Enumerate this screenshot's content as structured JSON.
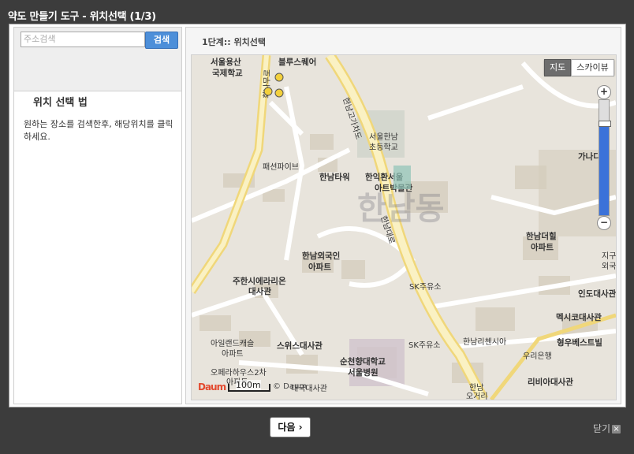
{
  "window": {
    "title": "약도 만들기 도구 - 위치선택 (1/3)"
  },
  "search": {
    "placeholder": "주소검색",
    "button": "검색"
  },
  "help": {
    "title": "위치 선택 법",
    "text": "원하는 장소를 검색한후, 해당위치를 클릭하세요."
  },
  "step": {
    "title": "1단계:: 위치선택"
  },
  "map": {
    "type_buttons": {
      "map": "지도",
      "sky": "스카이뷰"
    },
    "zoom_in": "+",
    "zoom_out": "−",
    "scale": "100m",
    "logo": "Daum",
    "copyright": "© Daum",
    "district": "한남동",
    "labels": {
      "l1": "서울용산",
      "l2": "국제학교",
      "l3": "블루스퀘어",
      "l4": "한남고가차도",
      "l5": "서울한남",
      "l6": "초등학교",
      "l7": "패션파이브",
      "l8": "한남타워",
      "l9": "한익환서울",
      "l10": "아트박물관",
      "l11": "가나다",
      "l12": "한남외국인",
      "l13": "아파트",
      "l14": "한남더힐",
      "l15": "아파트",
      "l16": "주한시에라리온",
      "l17": "대사관",
      "l18": "SK주유소",
      "l19": "인도대사관",
      "l20": "멕시코대사관",
      "l21": "아일랜드캐슬",
      "l22": "아파트",
      "l23": "스위스대사관",
      "l24": "SK주유소",
      "l25": "한남리첸시아",
      "l26": "형우베스트빌",
      "l27": "순천향대학교",
      "l28": "서울병원",
      "l29": "우리은행",
      "l30": "오페라하우스2차",
      "l31": "아파트",
      "l32": "대국대사관",
      "l33": "리비아대사관",
      "l34": "한남",
      "l35": "오거리",
      "l36": "지구",
      "l37": "외국",
      "l38": "한남대로",
      "l39": "회나무로"
    }
  },
  "footer": {
    "next": "다음 ›",
    "close": "닫기",
    "close_icon": "×"
  }
}
